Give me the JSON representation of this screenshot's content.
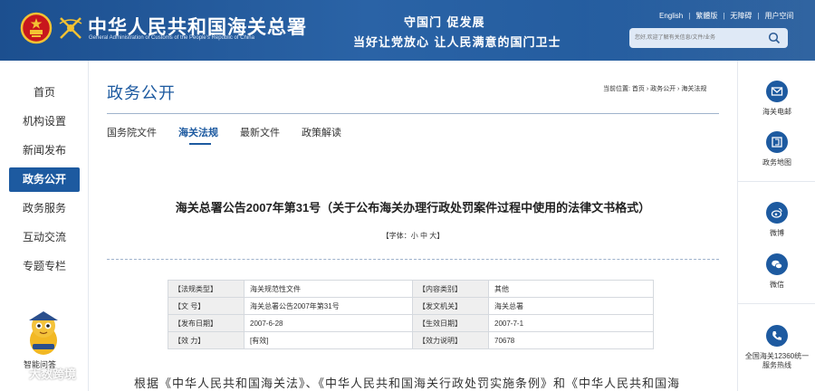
{
  "header": {
    "site_title": "中华人民共和国海关总署",
    "site_subtitle": "General Administration of Customs of the People's Republic of China",
    "slogan_line1": "守国门  促发展",
    "slogan_line2": "当好让党放心   让人民满意的国门卫士",
    "top_links": [
      "English",
      "繁體版",
      "无障碍",
      "用户空间"
    ],
    "search_placeholder": "您好,欢迎了解有关信息/文件/业务",
    "bg_color": "#1c4f8f"
  },
  "leftnav": {
    "items": [
      {
        "label": "首页"
      },
      {
        "label": "机构设置"
      },
      {
        "label": "新闻发布"
      },
      {
        "label": "政务公开",
        "active": true
      },
      {
        "label": "政务服务"
      },
      {
        "label": "互动交流"
      },
      {
        "label": "专题专栏"
      }
    ],
    "mascot_label": "智能问答",
    "active_color": "#1d5aa0"
  },
  "main": {
    "page_title": "政务公开",
    "breadcrumb": "当前位置: 首页 › 政务公开 › 海关法规",
    "tabs": [
      {
        "label": "国务院文件"
      },
      {
        "label": "海关法规",
        "active": true
      },
      {
        "label": "最新文件"
      },
      {
        "label": "政策解读"
      }
    ],
    "article_title": "海关总署公告2007年第31号（关于公布海关办理行政处罚案件过程中使用的法律文书格式）",
    "font_size_control": "【字体：小 中 大】",
    "info_table": [
      [
        "【法规类型】",
        "海关规范性文件",
        "【内容类别】",
        "其他"
      ],
      [
        "【文      号】",
        "海关总署公告2007年第31号",
        "【发文机关】",
        "海关总署"
      ],
      [
        "【发布日期】",
        "2007-6-28",
        "【生效日期】",
        "2007-7-1"
      ],
      [
        "【效      力】",
        "[有效]",
        "【效力说明】",
        "70678"
      ]
    ],
    "body_text": "根据《中华人民共和国海关法》、《中华人民共和国海关行政处罚实施条例》和《中华人民共和国海"
  },
  "rightbar": {
    "items": [
      {
        "label": "海关电邮",
        "icon": "mail-icon"
      },
      {
        "label": "政务地图",
        "icon": "map-icon"
      },
      {
        "label": "微博",
        "icon": "weibo-icon"
      },
      {
        "label": "微信",
        "icon": "wechat-icon"
      },
      {
        "label": "全国海关12360统一服务热线",
        "icon": "phone-icon"
      }
    ]
  },
  "watermark": {
    "text": "大数跨境"
  }
}
